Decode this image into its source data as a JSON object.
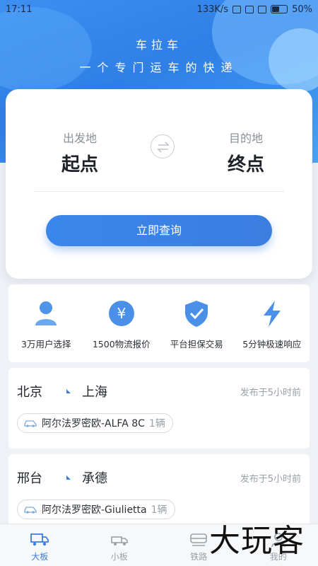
{
  "status_bar": {
    "time": "17:11",
    "net_speed": "133K/s",
    "battery": "50%"
  },
  "hero": {
    "title": "车拉车",
    "subtitle": "一个专门运车的快递"
  },
  "route": {
    "origin_label": "出发地",
    "origin_value": "起点",
    "dest_label": "目的地",
    "dest_value": "终点",
    "query_button": "立即查询"
  },
  "features": [
    {
      "icon": "user-icon",
      "label": "3万用户选择"
    },
    {
      "icon": "yuan-icon",
      "label": "1500物流报价"
    },
    {
      "icon": "shield-check-icon",
      "label": "平台担保交易"
    },
    {
      "icon": "lightning-icon",
      "label": "5分钟极速响应"
    }
  ],
  "orders": [
    {
      "from": "北京",
      "to": "上海",
      "time": "发布于5小时前",
      "car": "阿尔法罗密欧-ALFA 8C",
      "count": "1辆"
    },
    {
      "from": "邢台",
      "to": "承德",
      "time": "发布于5小时前",
      "car": "阿尔法罗密欧-Giulietta",
      "count": "1辆"
    }
  ],
  "tabs": [
    {
      "icon": "big-truck-icon",
      "label": "大板",
      "active": true
    },
    {
      "icon": "small-truck-icon",
      "label": "小板"
    },
    {
      "icon": "train-icon",
      "label": "铁路"
    },
    {
      "icon": "profile-icon",
      "label": "我的"
    }
  ],
  "watermark": "大玩客",
  "colors": {
    "primary": "#3a7ee0",
    "hero": "#2f7fe6",
    "background": "#eef1f5"
  }
}
